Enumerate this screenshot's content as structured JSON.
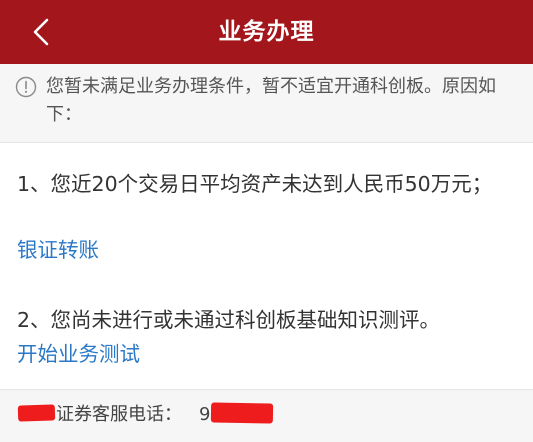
{
  "header": {
    "title": "业务办理",
    "back_icon": "chevron-left-icon",
    "background": "#a3161b"
  },
  "notice": {
    "icon": "info-icon",
    "text": "您暂未满足业务办理条件，暂不适宜开通科创板。原因如下："
  },
  "reasons": [
    {
      "text": "1、您近20个交易日平均资产未达到人民币50万元；",
      "action_label": "银证转账"
    },
    {
      "text": "2、您尚未进行或未通过科创板基础知识测评。",
      "action_label": "开始业务测试"
    }
  ],
  "footer": {
    "hotline_label": "证券客服电话：",
    "phone_visible_prefix": "9"
  },
  "colors": {
    "link": "#2a78c7",
    "redaction": "#ee1c1c"
  }
}
